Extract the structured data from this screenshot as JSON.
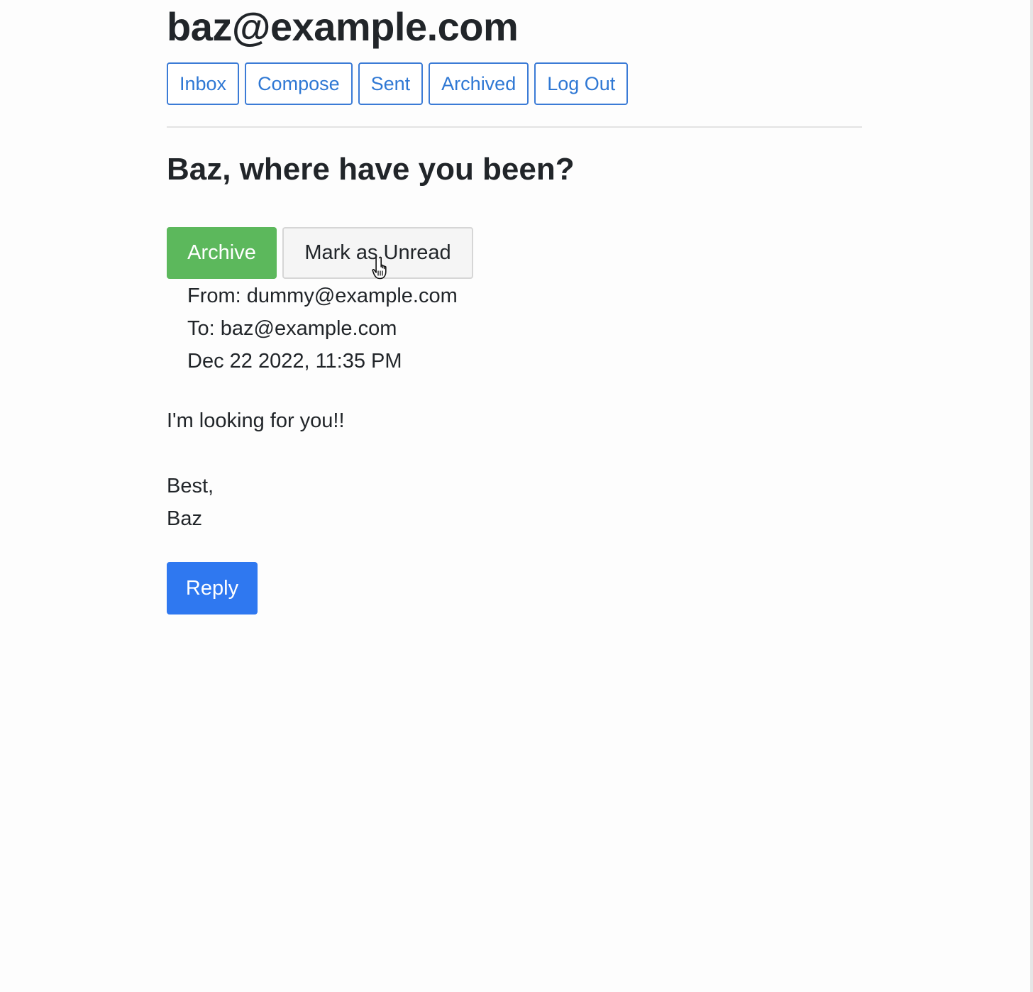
{
  "header": {
    "account_email": "baz@example.com"
  },
  "nav": {
    "inbox": "Inbox",
    "compose": "Compose",
    "sent": "Sent",
    "archived": "Archived",
    "logout": "Log Out"
  },
  "email": {
    "subject": "Baz, where have you been?",
    "from": "From: dummy@example.com",
    "to": "To: baz@example.com",
    "timestamp": "Dec 22 2022, 11:35 PM",
    "body_line": "I'm looking for you!!",
    "signoff": "Best,",
    "signature": "Baz"
  },
  "actions": {
    "archive_label": "Archive",
    "mark_unread_label": "Mark as Unread",
    "reply_label": "Reply"
  },
  "colors": {
    "link_blue": "#2f78d4",
    "archive_green": "#5cb85c",
    "reply_blue": "#2f78f0"
  },
  "cursor": {
    "icon": "hand-pointer-icon"
  }
}
